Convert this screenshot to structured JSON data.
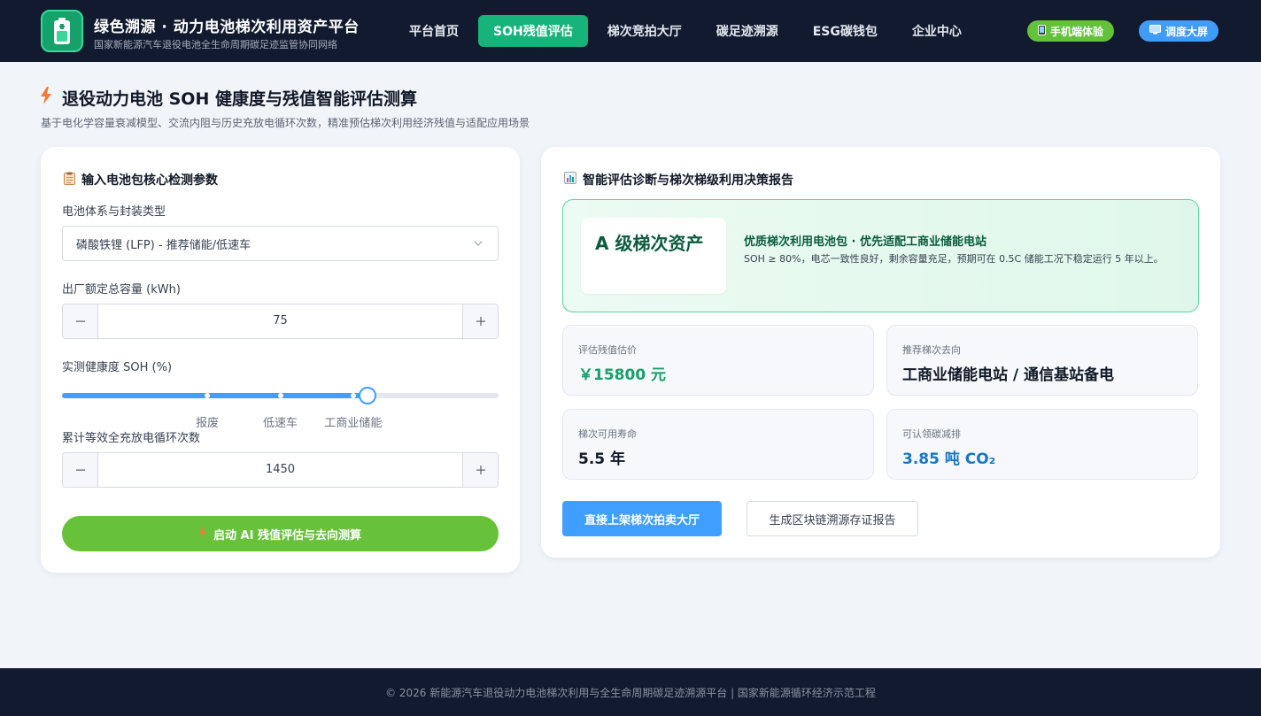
{
  "header": {
    "brand_title": "绿色溯源 · 动力电池梯次利用资产平台",
    "brand_subtitle": "国家新能源汽车退役电池全生命周期碳足迹监管协同网络",
    "nav": [
      {
        "label": "平台首页",
        "active": false
      },
      {
        "label": "SOH残值评估",
        "active": true
      },
      {
        "label": "梯次竞拍大厅",
        "active": false
      },
      {
        "label": "碳足迹溯源",
        "active": false
      },
      {
        "label": "ESG碳钱包",
        "active": false
      },
      {
        "label": "企业中心",
        "active": false
      }
    ],
    "mobile_label": "手机端体验",
    "screen_label": "调度大屏"
  },
  "page": {
    "title": "退役动力电池 SOH 健康度与残值智能评估测算",
    "subtitle": "基于电化学容量衰减模型、交流内阻与历史充放电循环次数，精准预估梯次利用经济残值与适配应用场景"
  },
  "form": {
    "heading": "输入电池包核心检测参数",
    "chemistry_label": "电池体系与封装类型",
    "chemistry_value": "磷酸铁锂 (LFP) - 推荐储能/低速车",
    "capacity_label": "出厂额定总容量 (kWh)",
    "capacity_value": "75",
    "soh_label": "实测健康度 SOH (%)",
    "soh_value": 0.7,
    "soh_marks": [
      {
        "label": "报废",
        "pos": 0.333
      },
      {
        "label": "低速车",
        "pos": 0.5
      },
      {
        "label": "工商业储能",
        "pos": 0.667
      }
    ],
    "cycles_label": "累计等效全充放电循环次数",
    "cycles_value": "1450",
    "submit_label": "启动 AI 残值评估与去向测算"
  },
  "report": {
    "heading": "智能评估诊断与梯次梯级利用决策报告",
    "grade": "A 级梯次资产",
    "grade_title": "优质梯次利用电池包 · 优先适配工商业储能电站",
    "grade_desc": "SOH ≥ 80%，电芯一致性良好，剩余容量充足，预期可在 0.5C 储能工况下稳定运行 5 年以上。",
    "stats": {
      "value_label": "评估残值估价",
      "value": "￥15800 元",
      "dest_label": "推荐梯次去向",
      "dest": "工商业储能电站 / 通信基站备电",
      "life_label": "梯次可用寿命",
      "life": "5.5 年",
      "carbon_label": "可认领碳减排",
      "carbon": "3.85 吨 CO₂"
    },
    "list_button": "直接上架梯次拍卖大厅",
    "report_button": "生成区块链溯源存证报告"
  },
  "footer": {
    "text": "© 2026 新能源汽车退役动力电池梯次利用与全生命周期碳足迹溯源平台 | 国家新能源循环经济示范工程"
  },
  "colors": {
    "accent_green": "#16b47a",
    "primary_blue": "#409eff",
    "submit_green": "#67c23a",
    "header_bg": "#111a2e"
  },
  "icons": {
    "logo": "battery-icon",
    "mobile": "phone-icon",
    "screen": "monitor-icon",
    "title": "lightning-icon",
    "form": "clipboard-icon",
    "report": "bar-chart-icon"
  }
}
